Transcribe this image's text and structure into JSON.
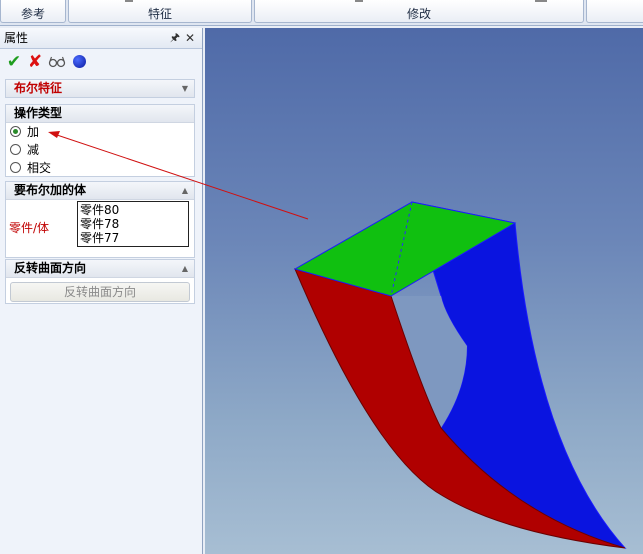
{
  "ribbon": {
    "groups": [
      {
        "label": "参考"
      },
      {
        "label": "特征"
      },
      {
        "label": "修改"
      }
    ]
  },
  "panel": {
    "title": "属性",
    "pin_icon": "pin-icon",
    "close_icon": "close-icon",
    "toolbar": {
      "ok_icon": "checkmark-icon",
      "cancel_icon": "cross-icon",
      "preview_icon": "glasses-icon",
      "help_icon": "blue-ball-icon"
    },
    "feature_section": {
      "title": "布尔特征"
    },
    "operation_section": {
      "title": "操作类型",
      "options": [
        {
          "label": "加",
          "selected": true
        },
        {
          "label": "减",
          "selected": false
        },
        {
          "label": "相交",
          "selected": false
        }
      ]
    },
    "bodies_section": {
      "title": "要布尔加的体",
      "field_label": "零件/体",
      "items": [
        "零件80",
        "零件78",
        "零件77"
      ]
    },
    "reverse_section": {
      "title": "反转曲面方向",
      "button_label": "反转曲面方向"
    }
  },
  "colors": {
    "top_face": "#10c010",
    "left_face": "#b00000",
    "right_face": "#0a14e0",
    "annotation_arrow": "#d01010",
    "feature_title": "#c00000"
  }
}
